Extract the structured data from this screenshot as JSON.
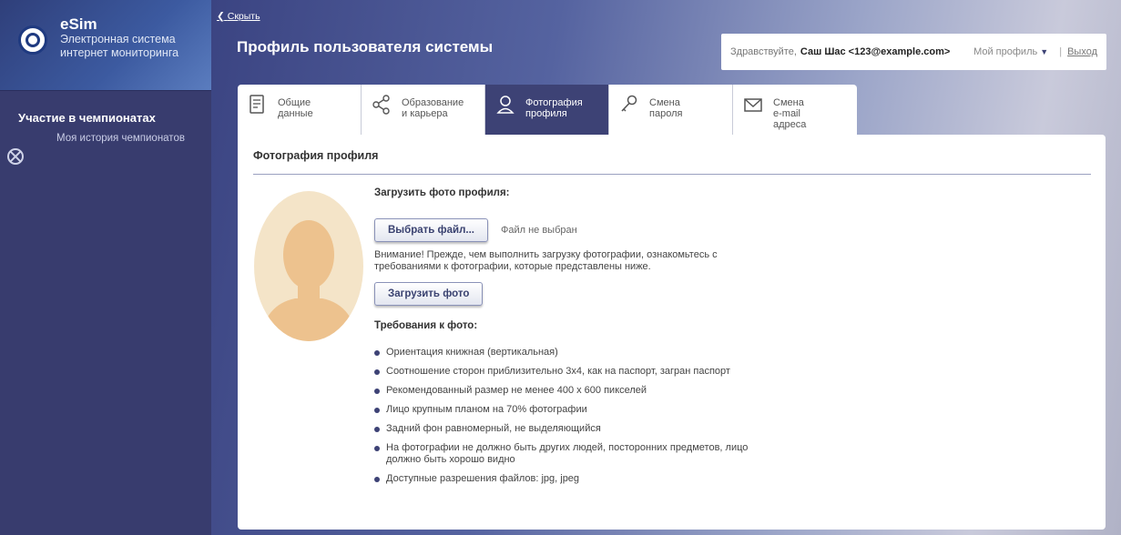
{
  "brand": {
    "name": "eSim",
    "subtitle_line1": "Электронная система",
    "subtitle_line2": "интернет мониторинга"
  },
  "sidebar": {
    "section_title": "Участие в чемпионатах",
    "items": [
      {
        "label": "Моя история чемпионатов",
        "icon": "circle-cross-icon"
      }
    ]
  },
  "header": {
    "hide_link": "Скрыть",
    "page_title": "Профиль пользователя системы",
    "greeting": "Здравствуйте,",
    "user_name": "Саш Шас <123@example.com>",
    "my_profile": "Мой профиль",
    "separator": "|",
    "logout": "Выход"
  },
  "tabs": [
    {
      "label": "Общие\nданные",
      "icon": "document-icon",
      "active": false
    },
    {
      "label": "Образование\nи карьера",
      "icon": "share-icon",
      "active": false
    },
    {
      "label": "Фотография\nпрофиля",
      "icon": "user-photo-icon",
      "active": true
    },
    {
      "label": "Смена\nпароля",
      "icon": "key-icon",
      "active": false
    },
    {
      "label": "Смена\ne-mail\nадреса",
      "icon": "envelope-icon",
      "active": false
    }
  ],
  "panel": {
    "title": "Фотография профиля",
    "upload_label": "Загрузить фото профиля:",
    "choose_file_button": "Выбрать файл...",
    "file_status": "Файл не выбран",
    "warning": "Внимание! Прежде, чем выполнить загрузку фотографии, ознакомьтесь с требованиями к фотографии, которые представлены ниже.",
    "upload_button": "Загрузить фото",
    "requirements_title": "Требования к фото:",
    "requirements": [
      "Ориентация книжная (вертикальная)",
      "Соотношение сторон приблизительно 3х4, как на паспорт, загран паспорт",
      "Рекомендованный размер не менее 400 x 600 пикселей",
      "Лицо крупным планом на 70% фотографии",
      "Задний фон равномерный, не выделяющийся",
      "На фотографии не должно быть других людей, посторонних предметов, лицо должно быть хорошо видно",
      "Доступные разрешения файлов: jpg, jpeg"
    ]
  },
  "colors": {
    "sidebar_bg": "#383c6e",
    "active_tab": "#3d4275",
    "bullet": "#3d4275",
    "avatar_bg": "#f4e4c8",
    "avatar_skin": "#edc28e"
  }
}
